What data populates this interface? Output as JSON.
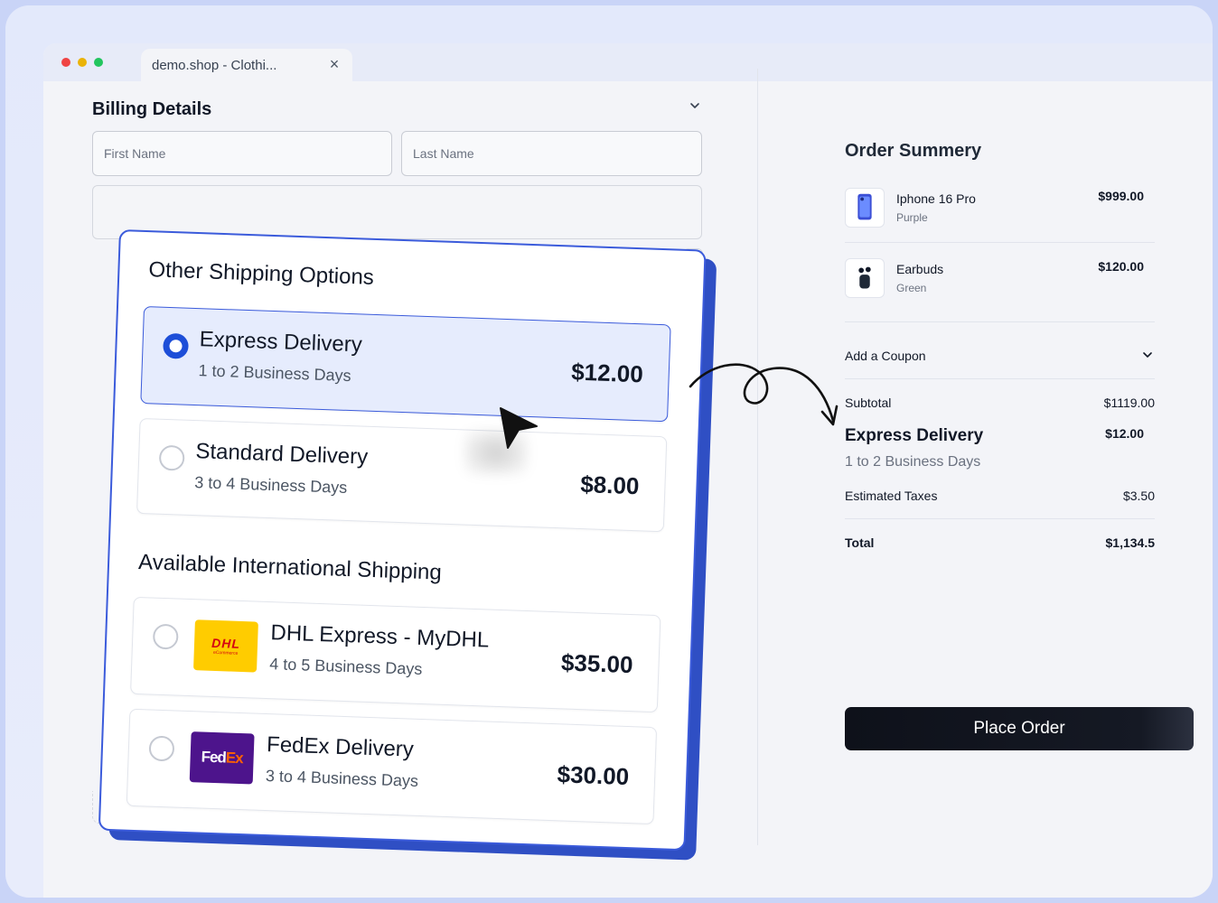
{
  "browser": {
    "tab_title": "demo.shop - Clothi...",
    "tab_close": "×"
  },
  "billing": {
    "title": "Billing Details",
    "first_name_placeholder": "First Name",
    "last_name_placeholder": "Last Name"
  },
  "shipping": {
    "other_title": "Other Shipping Options",
    "international_title": "Available International Shipping",
    "options": [
      {
        "title": "Express Delivery",
        "subtitle": "1 to 2 Business Days",
        "price": "$12.00",
        "selected": true
      },
      {
        "title": "Standard Delivery",
        "subtitle": "3 to 4 Business Days",
        "price": "$8.00",
        "selected": false
      },
      {
        "title": "DHL Express - MyDHL",
        "subtitle": "4 to 5 Business Days",
        "price": "$35.00",
        "selected": false,
        "logo": "DHL",
        "logo_sub": "eCommerce",
        "logo_color": "#ffcc00"
      },
      {
        "title": "FedEx Delivery",
        "subtitle": "3 to 4 Business Days",
        "price": "$30.00",
        "selected": false,
        "logo_a": "Fed",
        "logo_b": "Ex",
        "logo_color": "#4d148c"
      }
    ]
  },
  "summary": {
    "title": "Order Summery",
    "items": [
      {
        "name": "Iphone 16 Pro",
        "variant": "Purple",
        "price": "$999.00",
        "icon": "phone-icon"
      },
      {
        "name": "Earbuds",
        "variant": "Green",
        "price": "$120.00",
        "icon": "earbuds-icon"
      }
    ],
    "coupon_label": "Add a Coupon",
    "subtotal_label": "Subtotal",
    "subtotal_value": "$1119.00",
    "shipping_title": "Express Delivery",
    "shipping_price": "$12.00",
    "shipping_sub": "1 to 2 Business Days",
    "taxes_label": "Estimated Taxes",
    "taxes_value": "$3.50",
    "total_label": "Total",
    "total_value": "$1,134.5",
    "place_order": "Place Order"
  },
  "colors": {
    "accent": "#1d4ed8",
    "card_border": "#3b5bdb",
    "button": "#0e111a"
  }
}
